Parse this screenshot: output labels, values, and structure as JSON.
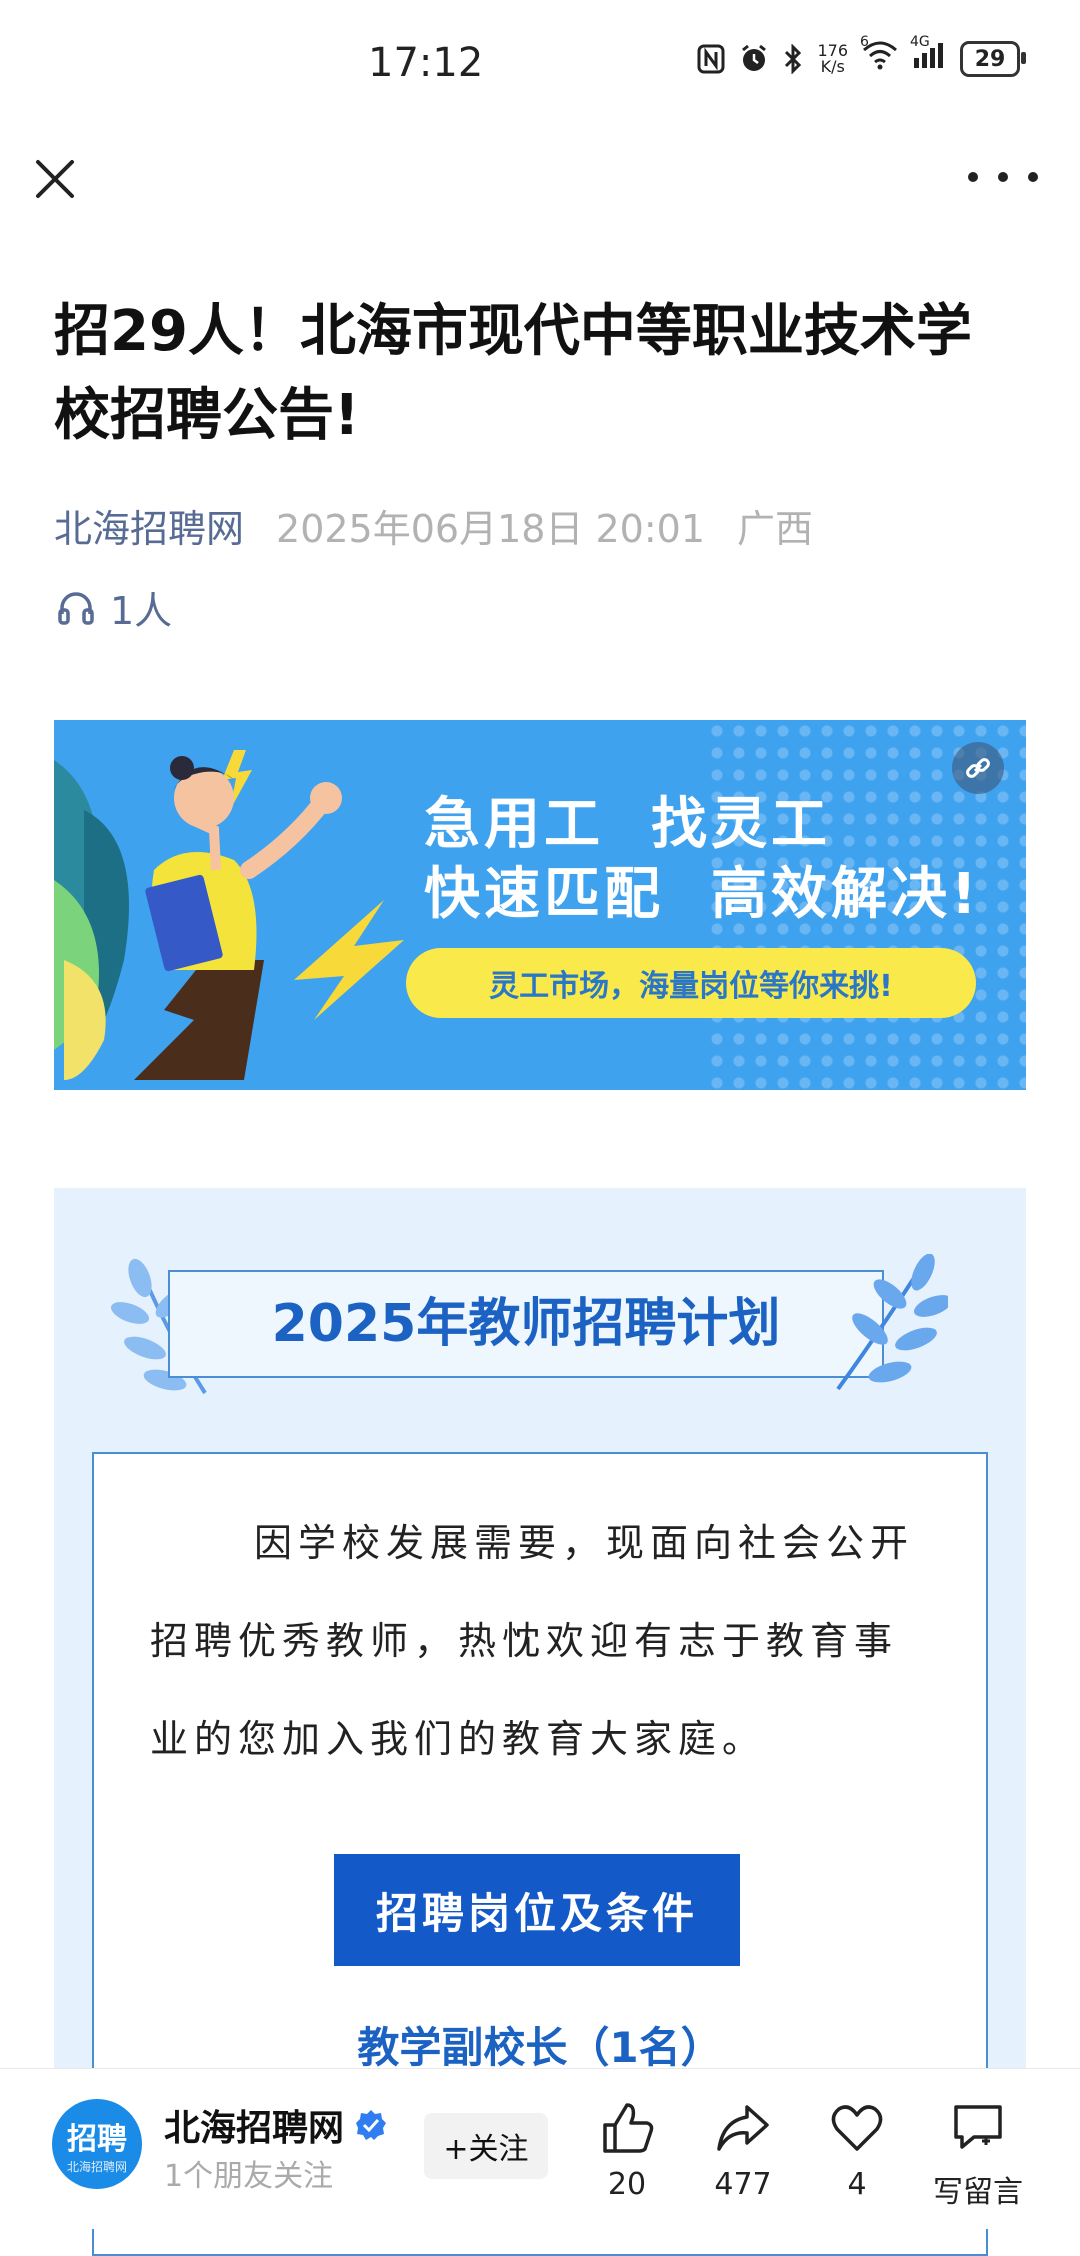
{
  "status_bar": {
    "time": "17:12",
    "network_speed_value": "176",
    "network_speed_unit": "K/s",
    "wifi_level": "6",
    "signal_type": "4G",
    "battery": "29",
    "icons": [
      "nfc-icon",
      "alarm-icon",
      "bluetooth-icon",
      "wifi-icon",
      "signal-icon",
      "battery-icon"
    ]
  },
  "nav": {
    "close_icon": "close-icon",
    "more_icon": "more-icon"
  },
  "article": {
    "title": "招29人！北海市现代中等职业技术学校招聘公告!",
    "account": "北海招聘网",
    "datetime": "2025年06月18日 20:01",
    "location": "广西",
    "listeners": "1人"
  },
  "banner": {
    "headline_line1": "急用工  找灵工",
    "headline_line2": "快速匹配  高效解决!",
    "pill_text": "灵工市场，海量岗位等你来挑!"
  },
  "section": {
    "plan_title": "2025年教师招聘计划",
    "intro_text": "因学校发展需要，现面向社会公开招聘优秀教师，热忱欢迎有志于教育事业的您加入我们的教育大家庭。",
    "cta_label": "招聘岗位及条件",
    "position_heading": "教学副校长（1名）"
  },
  "bottom_bar": {
    "avatar_text": "招聘",
    "avatar_subtext": "北海招聘网",
    "account_name": "北海招聘网",
    "followers_text": "1个朋友关注",
    "follow_label": "+关注",
    "like_count": "20",
    "share_count": "477",
    "favorite_count": "4",
    "comment_label": "写留言"
  },
  "colors": {
    "accent_blue": "#1459c8",
    "link_blue": "#576b95",
    "banner_blue": "#3fa2ef",
    "section_bg": "#e5f1fd",
    "pill_yellow": "#f9e94a"
  }
}
